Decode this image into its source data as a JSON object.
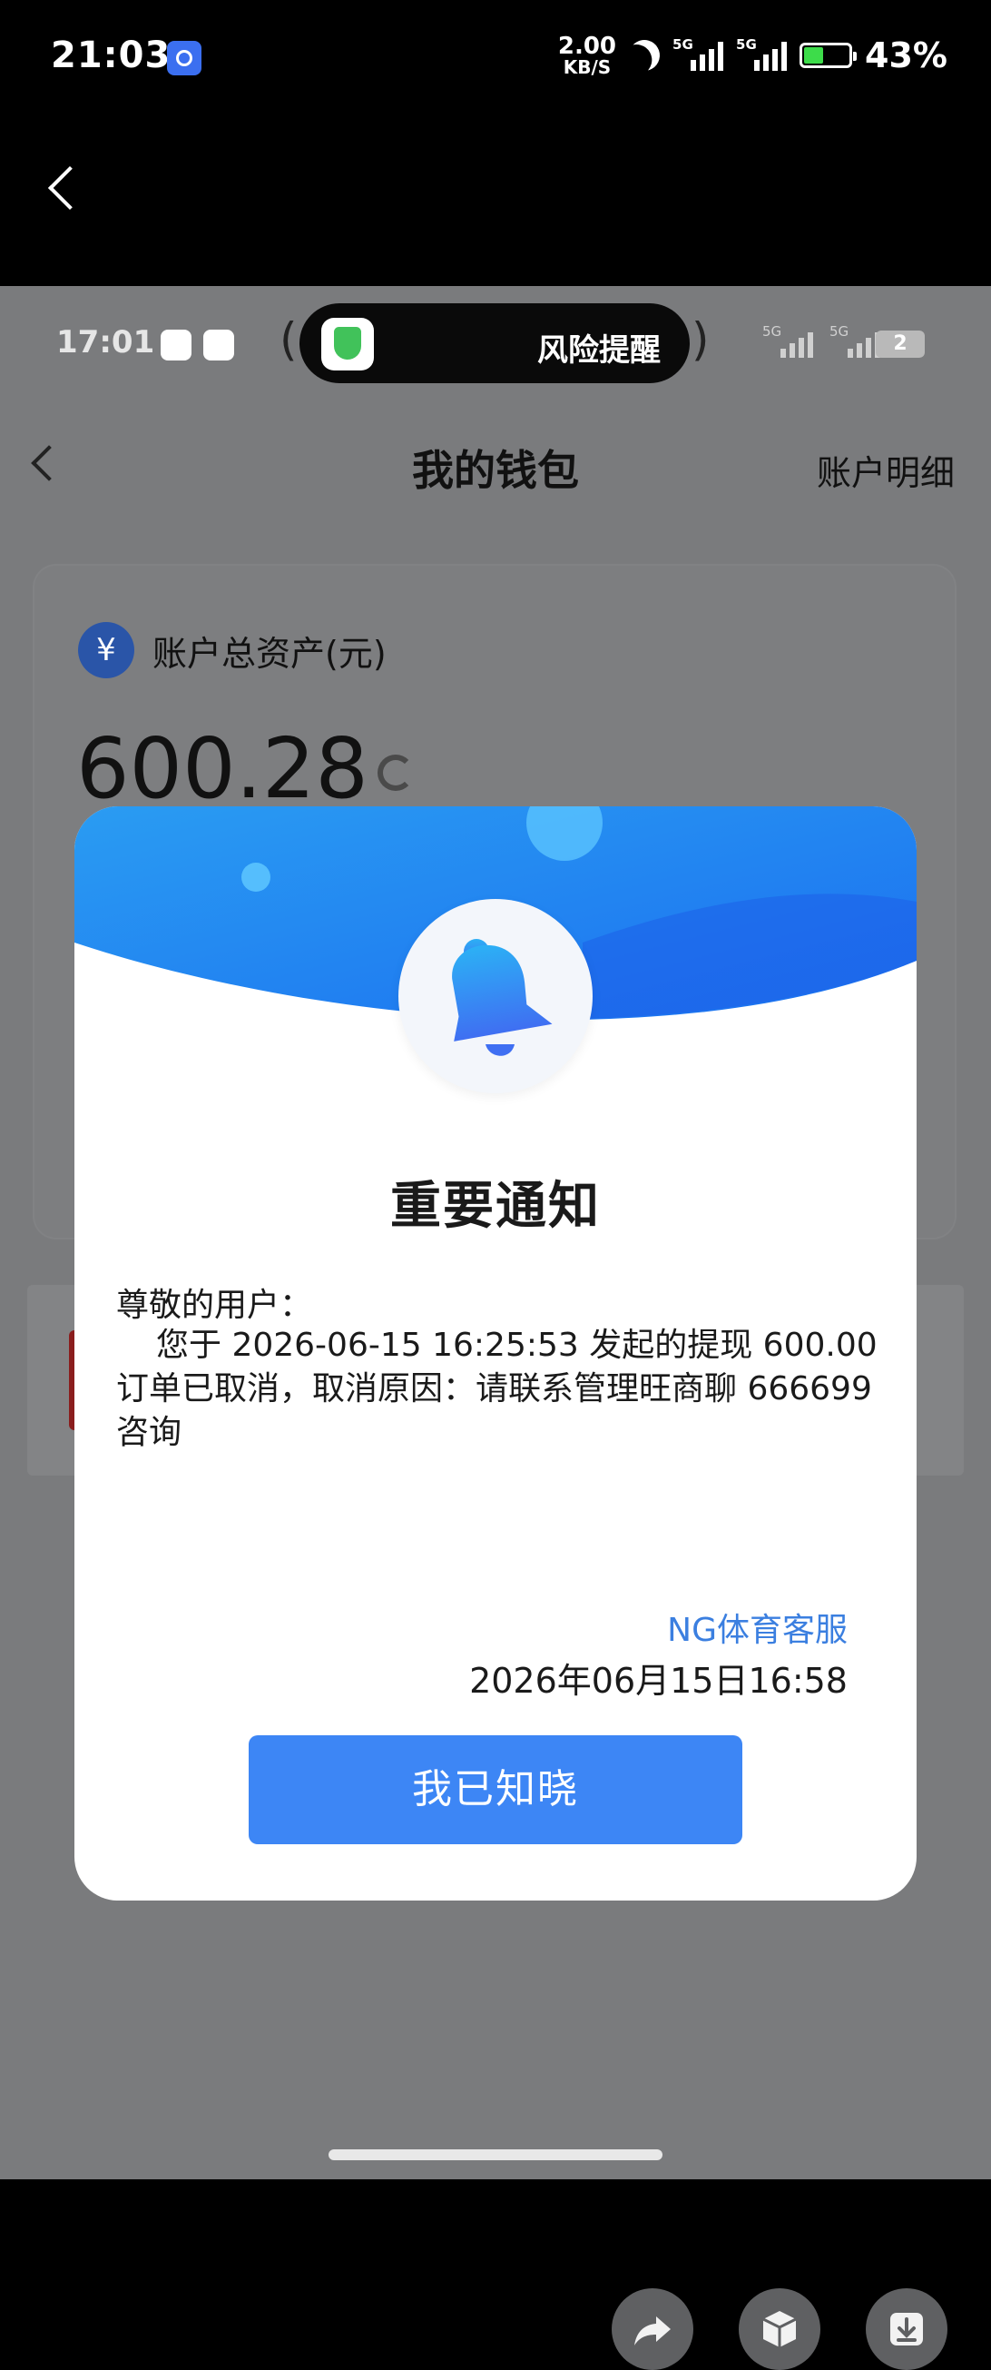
{
  "outer_status": {
    "time": "21:03",
    "speed_value": "2.00",
    "speed_unit": "KB/S",
    "network1": "5G",
    "network2": "5G",
    "battery": "43%"
  },
  "inner_status": {
    "time": "17:01",
    "risk_label": "风险提醒",
    "network1": "5G",
    "network2": "5G",
    "badge": "2"
  },
  "header": {
    "title": "我的钱包",
    "detail_link": "账户明细"
  },
  "wallet": {
    "currency_symbol": "¥",
    "asset_label": "账户总资产(元)",
    "amount": "600.28"
  },
  "modal": {
    "heading": "重要通知",
    "greeting": "尊敬的用户：",
    "body": "您于 2026-06-15 16:25:53 发起的提现 600.00 订单已取消，取消原因：请联系管理旺商聊 666699 咨询",
    "signer": "NG体育客服",
    "date": "2026年06月15日16:58",
    "button": "我已知晓"
  },
  "colors": {
    "accent": "#3d86f5",
    "signer": "#3b7fe0",
    "overlay": "#7a7b7d"
  }
}
